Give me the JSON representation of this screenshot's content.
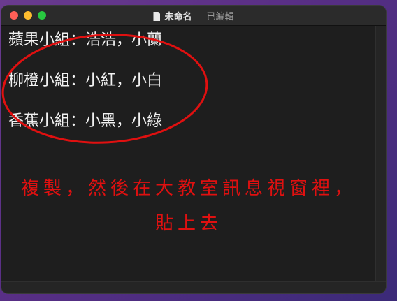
{
  "window": {
    "title": "未命名",
    "separator": "—",
    "status": "已編輯",
    "file_icon": "document-icon"
  },
  "document": {
    "lines": [
      "蘋果小組：浩浩，小蘭",
      "柳橙小組：小紅，小白",
      "香蕉小組：小黑，小綠"
    ]
  },
  "annotation": {
    "color": "#e01010",
    "instruction_line_1": "複製，然後在大教室訊息視窗裡，",
    "instruction_line_2": "貼上去"
  },
  "colors": {
    "close": "#ff5f57",
    "minimize": "#febc2e",
    "maximize": "#28c840",
    "editor_bg": "#1e1e1e"
  }
}
